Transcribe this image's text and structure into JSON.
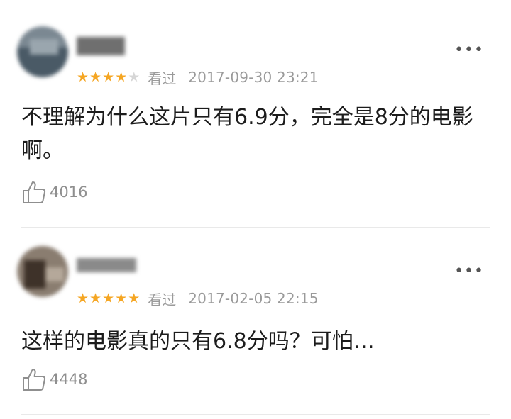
{
  "comments": [
    {
      "user": "",
      "rating": 4,
      "status": "看过",
      "time": "2017-09-30 23:21",
      "text": "不理解为什么这片只有6.9分，完全是8分的电影啊。",
      "likes": "4016",
      "avatar_color": "#5b6b78"
    },
    {
      "user": "",
      "rating": 5,
      "status": "看过",
      "time": "2017-02-05 22:15",
      "text": "这样的电影真的只有6.8分吗？可怕…",
      "likes": "4448",
      "avatar_color": "#5a4a3e"
    }
  ],
  "colors": {
    "star": "#f5a623",
    "meta": "#9a9a9a"
  },
  "icons": {
    "more": "more-dots-icon",
    "like": "thumbs-up-icon"
  }
}
